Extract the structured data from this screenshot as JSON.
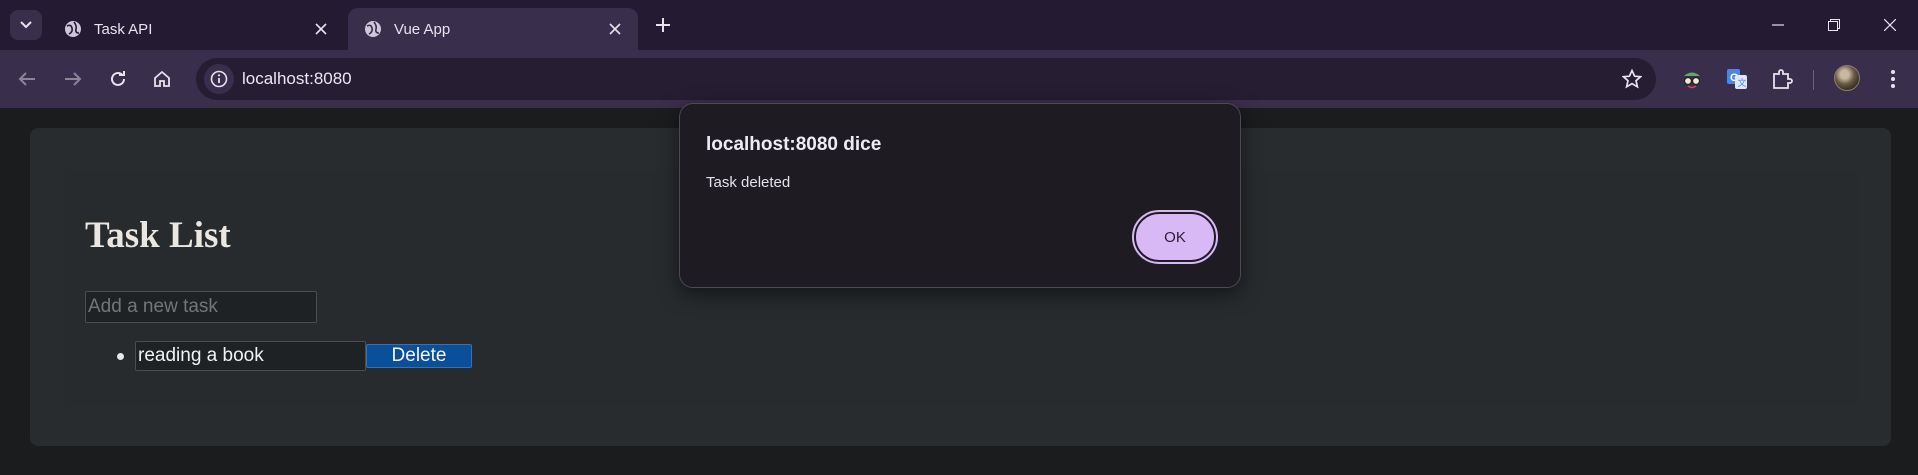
{
  "browser": {
    "tabs": [
      {
        "title": "Task API",
        "favicon": "globe-icon",
        "active": false
      },
      {
        "title": "Vue App",
        "favicon": "globe-icon",
        "active": true
      }
    ],
    "url": "localhost:8080",
    "toolbar_icons": [
      "back-icon",
      "forward-icon",
      "reload-icon",
      "home-icon",
      "site-info-icon",
      "bookmark-star-icon",
      "extension-spy-icon",
      "google-translate-icon",
      "extensions-puzzle-icon",
      "profile-avatar",
      "menu-kebab-icon"
    ]
  },
  "app": {
    "title": "Task List",
    "new_task_placeholder": "Add a new task",
    "tasks": [
      {
        "text": "reading a book",
        "delete_label": "Delete"
      }
    ]
  },
  "dialog": {
    "title": "localhost:8080 dice",
    "message": "Task deleted",
    "ok_label": "OK"
  },
  "colors": {
    "tabstrip": "#241a31",
    "toolbar": "#3a2e4d",
    "page_bg": "#1a1c1d",
    "card_bg": "#282c2e",
    "delete_button": "#0a4f9a",
    "dialog_ok": "#d8b9f6"
  }
}
